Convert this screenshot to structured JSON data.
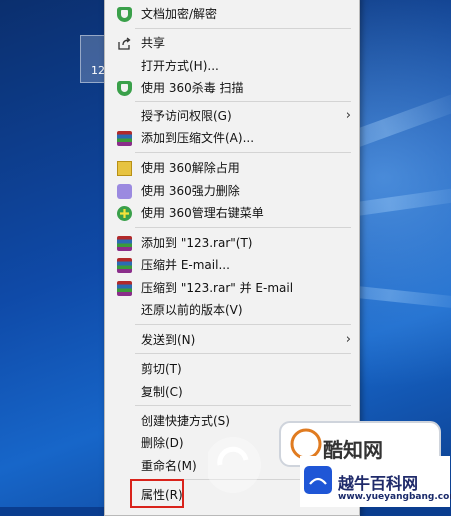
{
  "desktop": {
    "icon_label": "12"
  },
  "menu": {
    "items": [
      {
        "label": "文档加密/解密",
        "icon": "shield-icon"
      },
      {
        "label": "共享",
        "icon": "share-icon"
      },
      {
        "label": "打开方式(H)...",
        "icon": ""
      },
      {
        "label": "使用 360杀毒 扫描",
        "icon": "shield-icon"
      },
      {
        "label": "授予访问权限(G)",
        "icon": "",
        "submenu": true
      },
      {
        "label": "添加到压缩文件(A)...",
        "icon": "rar-icon"
      },
      {
        "label": "使用 360解除占用",
        "icon": "unlock-icon"
      },
      {
        "label": "使用 360强力删除",
        "icon": "shred-icon"
      },
      {
        "label": "使用 360管理右键菜单",
        "icon": "manage-icon"
      },
      {
        "label": "添加到 \"123.rar\"(T)",
        "icon": "rar-icon"
      },
      {
        "label": "压缩并 E-mail...",
        "icon": "rar-icon"
      },
      {
        "label": "压缩到 \"123.rar\" 并 E-mail",
        "icon": "rar-icon"
      },
      {
        "label": "还原以前的版本(V)",
        "icon": ""
      },
      {
        "label": "发送到(N)",
        "icon": "",
        "submenu": true
      },
      {
        "label": "剪切(T)",
        "icon": ""
      },
      {
        "label": "复制(C)",
        "icon": ""
      },
      {
        "label": "创建快捷方式(S)",
        "icon": ""
      },
      {
        "label": "删除(D)",
        "icon": ""
      },
      {
        "label": "重命名(M)",
        "icon": ""
      },
      {
        "label": "属性(R)",
        "icon": ""
      }
    ],
    "submenu_arrow": "›"
  },
  "watermark": {
    "brand": "酷知网",
    "site_name": "越牛百科网",
    "site_url": "www.yueyangbang.com"
  },
  "colors": {
    "highlight_border": "#d9231b",
    "menu_bg": "#f2f2f2"
  }
}
